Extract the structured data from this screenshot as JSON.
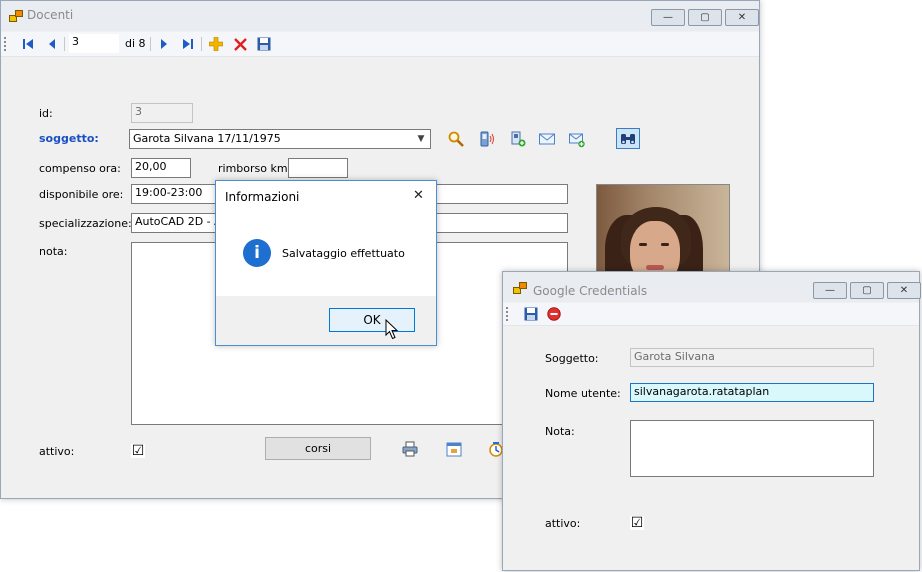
{
  "docenti": {
    "title": "Docenti",
    "nav": {
      "position": "3",
      "of_label": "di 8"
    },
    "labels": {
      "id": "id:",
      "soggetto": "soggetto:",
      "compenso": "compenso ora:",
      "rimborso": "rimborso km:",
      "disponibile": "disponibile ore:",
      "specializzazione": "specializzazione:",
      "nota": "nota:",
      "attivo": "attivo:"
    },
    "values": {
      "id": "3",
      "soggetto": "Garota Silvana 17/11/1975",
      "compenso": "20,00",
      "rimborso": "",
      "disponibile": "19:00-23:00",
      "specializzazione": "AutoCAD 2D - Au",
      "nota": "",
      "attivo_checked": "☑"
    },
    "corsi_button": "corsi"
  },
  "dialog": {
    "title": "Informazioni",
    "message": "Salvataggio effettuato",
    "info_glyph": "i",
    "ok_button": "OK",
    "close_glyph": "✕"
  },
  "google": {
    "title": "Google Credentials",
    "labels": {
      "soggetto": "Soggetto:",
      "nome_utente": "Nome utente:",
      "nota": "Nota:",
      "attivo": "attivo:"
    },
    "values": {
      "soggetto": "Garota Silvana",
      "nome_utente": "silvanagarota.ratataplan",
      "nota": "",
      "attivo_checked": "☑"
    }
  },
  "window_controls": {
    "minimize": "—",
    "maximize": "▢",
    "close": "✕"
  }
}
